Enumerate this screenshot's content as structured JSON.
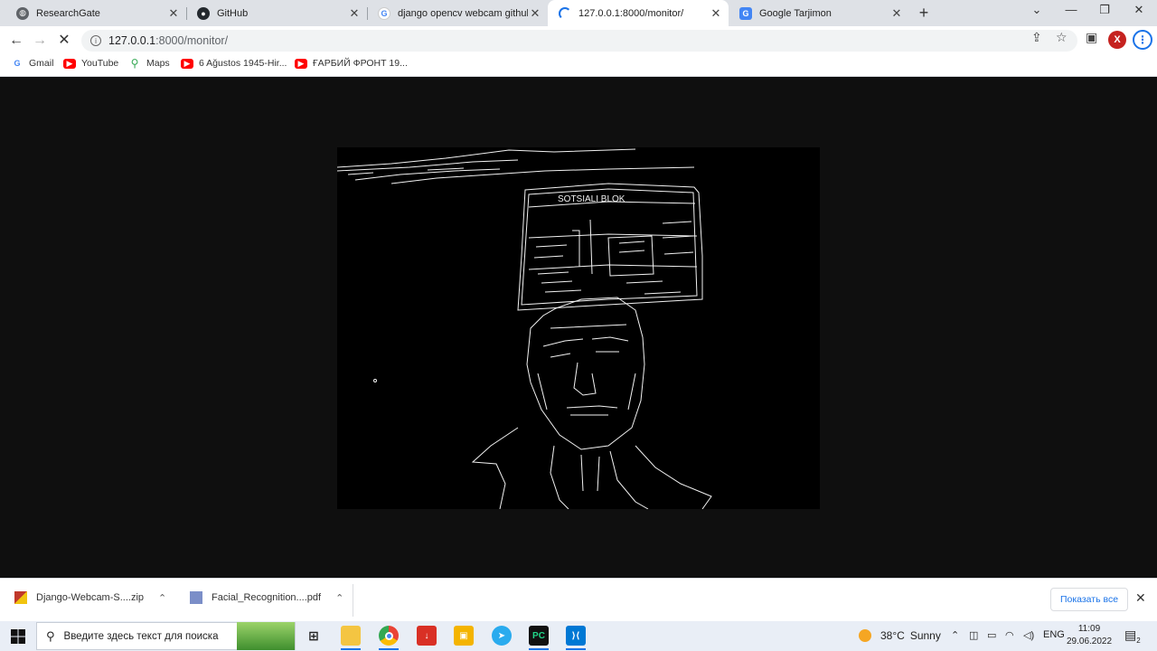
{
  "tabs": [
    {
      "title": "ResearchGate",
      "icon": "globe-icon"
    },
    {
      "title": "GitHub",
      "icon": "github-icon"
    },
    {
      "title": "django opencv webcam github -",
      "icon": "google-icon"
    },
    {
      "title": "127.0.0.1:8000/monitor/",
      "icon": "loading-icon",
      "active": true
    },
    {
      "title": "Google Tarjimon",
      "icon": "translate-icon"
    }
  ],
  "address": {
    "host": "127.0.0.1",
    "rest": ":8000/monitor/"
  },
  "bookmarks": [
    {
      "label": "Gmail",
      "icon": "google-icon"
    },
    {
      "label": "YouTube",
      "icon": "youtube-icon"
    },
    {
      "label": "Maps",
      "icon": "maps-icon"
    },
    {
      "label": "6 Ağustos 1945-Hir...",
      "icon": "youtube-icon"
    },
    {
      "label": "ҒАРБИЙ ФРОНТ 19...",
      "icon": "youtube-icon"
    }
  ],
  "profile_initial": "X",
  "downloads": [
    {
      "name": "Django-Webcam-S....zip"
    },
    {
      "name": "Facial_Recognition....pdf"
    }
  ],
  "show_all_label": "Показать все",
  "taskbar": {
    "search_placeholder": "Введите здесь текст для поиска",
    "weather_temp": "38°C",
    "weather_text": "Sunny",
    "lang": "ENG",
    "time": "11:09",
    "date": "29.06.2022",
    "notif_count": "2"
  },
  "video_sign_text": "SOTSIALI BLOK"
}
